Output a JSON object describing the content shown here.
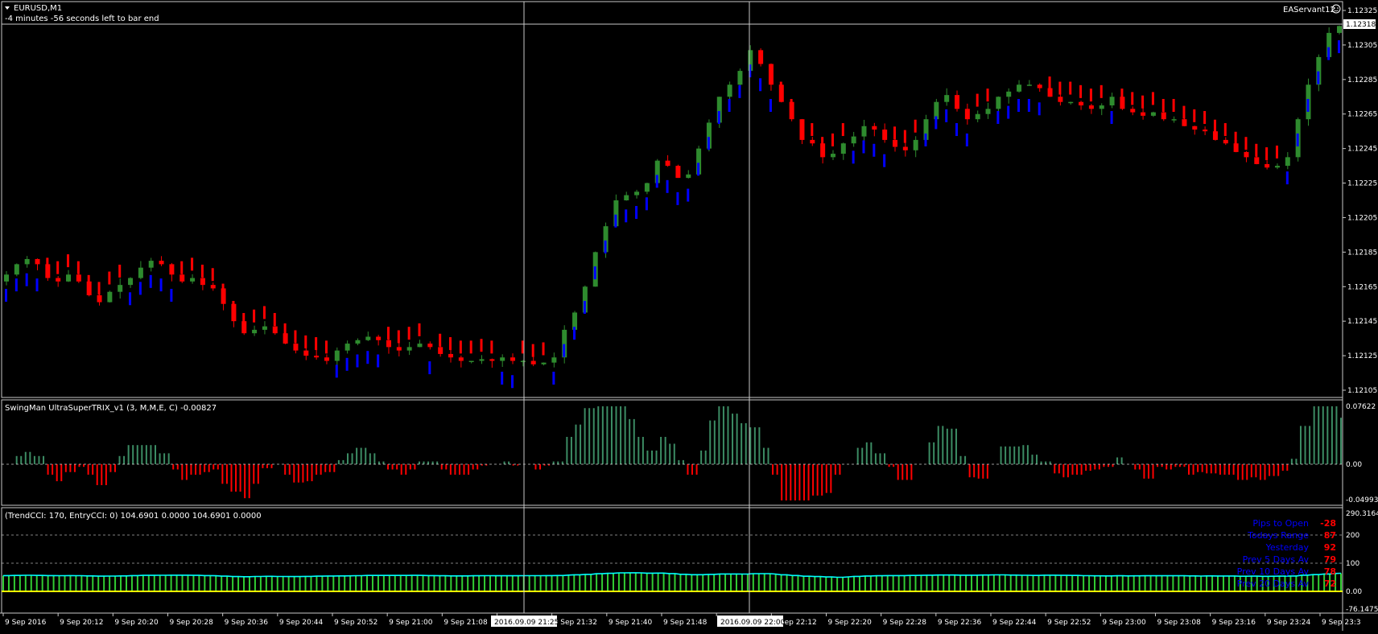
{
  "window": {
    "symbol_title": "EURUSD,M1",
    "countdown": "-4 minutes -56 seconds left to bar end",
    "expert_name": "EAServant12",
    "current_price": "1.12318"
  },
  "main_panel": {
    "price_ticks": [
      "1.12325",
      "1.12305",
      "1.12285",
      "1.12265",
      "1.12245",
      "1.12225",
      "1.12205",
      "1.12185",
      "1.12165",
      "1.12145",
      "1.12125",
      "1.12105"
    ]
  },
  "trix_panel": {
    "label": "SwingMan UltraSuperTRIX_v1 (3, M,M,E, C) -0.00827",
    "ticks": [
      "0.07622",
      "0.00",
      "-0.04993"
    ]
  },
  "cci_panel": {
    "label": "(TrendCCI: 170, EntryCCI: 0)  104.6901 0.0000 104.6901 0.0000",
    "ticks": [
      "290.3164",
      "200",
      "100",
      "0.00",
      "-76.1475"
    ]
  },
  "stats": [
    {
      "label": "Pips to Open",
      "value": "-28"
    },
    {
      "label": "Todays Range",
      "value": "87"
    },
    {
      "label": "Yesterday",
      "value": "92"
    },
    {
      "label": "Prev 5 Days Av",
      "value": "79"
    },
    {
      "label": "Prev 10 Days Av",
      "value": "78"
    },
    {
      "label": "Prev 20 Days Av",
      "value": "72"
    }
  ],
  "time_axis": {
    "labels": [
      "9 Sep 2016",
      "9 Sep 20:12",
      "9 Sep 20:20",
      "9 Sep 20:28",
      "9 Sep 20:36",
      "9 Sep 20:44",
      "9 Sep 20:52",
      "9 Sep 21:00",
      "9 Sep 21:08",
      "9 Sep 2",
      "9 Sep 21:32",
      "9 Sep 21:40",
      "9 Sep 21:48",
      "9 Sep 22:04",
      "9 Sep 22:12",
      "9 Sep 22:20",
      "9 Sep 22:28",
      "9 Sep 22:36",
      "9 Sep 22:44",
      "9 Sep 22:52",
      "9 Sep 23:00",
      "9 Sep 23:08",
      "9 Sep 23:16",
      "9 Sep 23:24",
      "9 Sep 23:3"
    ],
    "crosshair_labels": [
      "2016.09.09 21:25",
      "2016.09.09 22:00"
    ]
  },
  "colors": {
    "bull_candle": "#2e8b2e",
    "bear_candle": "#ff0000",
    "trend_up": "#0000ff",
    "trend_down": "#ff0000",
    "trix_up": "#3c8c64",
    "trix_down": "#ff0000",
    "cci_up": "#32cd32",
    "cci_down": "#ff0000",
    "cci_line": "#00ffff",
    "zero_line": "#ffff00",
    "stats_label": "#0000ff",
    "stats_value": "#ff0000"
  },
  "chart_data": {
    "type": "candlestick",
    "close_series_approx": [
      1.12172,
      1.12178,
      1.12181,
      1.12178,
      1.1217,
      1.12168,
      1.12172,
      1.12168,
      1.1216,
      1.12156,
      1.12162,
      1.12166,
      1.1217,
      1.12176,
      1.1218,
      1.12178,
      1.12172,
      1.12168,
      1.1217,
      1.12166,
      1.12164,
      1.12155,
      1.12145,
      1.12138,
      1.1214,
      1.12142,
      1.12138,
      1.12132,
      1.12128,
      1.12125,
      1.12124,
      1.12122,
      1.12128,
      1.12132,
      1.12134,
      1.12136,
      1.12134,
      1.1213,
      1.12128,
      1.1213,
      1.12132,
      1.1213,
      1.12126,
      1.12124,
      1.12122,
      1.12122,
      1.12123,
      1.12122,
      1.12124,
      1.12122,
      1.12122,
      1.1212,
      1.12121,
      1.12124,
      1.1214,
      1.1215,
      1.12165,
      1.12185,
      1.122,
      1.12215,
      1.12218,
      1.1222,
      1.12225,
      1.12238,
      1.12235,
      1.12228,
      1.1223,
      1.12245,
      1.1226,
      1.12275,
      1.12282,
      1.1229,
      1.12302,
      1.12294,
      1.12282,
      1.12272,
      1.12262,
      1.1225,
      1.12248,
      1.1224,
      1.12242,
      1.12248,
      1.12252,
      1.12258,
      1.12256,
      1.1225,
      1.12246,
      1.12244,
      1.1225,
      1.12262,
      1.12272,
      1.12276,
      1.12268,
      1.12262,
      1.12265,
      1.12268,
      1.12275,
      1.12278,
      1.12282,
      1.12282,
      1.1228,
      1.12275,
      1.12272,
      1.12272,
      1.1227,
      1.12268,
      1.1227,
      1.12275,
      1.12268,
      1.12266,
      1.12264,
      1.12266,
      1.12262,
      1.12262,
      1.12258,
      1.12256,
      1.12255,
      1.1225,
      1.12248,
      1.12243,
      1.1224,
      1.12236,
      1.12234,
      1.12235,
      1.1224,
      1.12262,
      1.12282,
      1.12298,
      1.12312,
      1.12316
    ]
  }
}
